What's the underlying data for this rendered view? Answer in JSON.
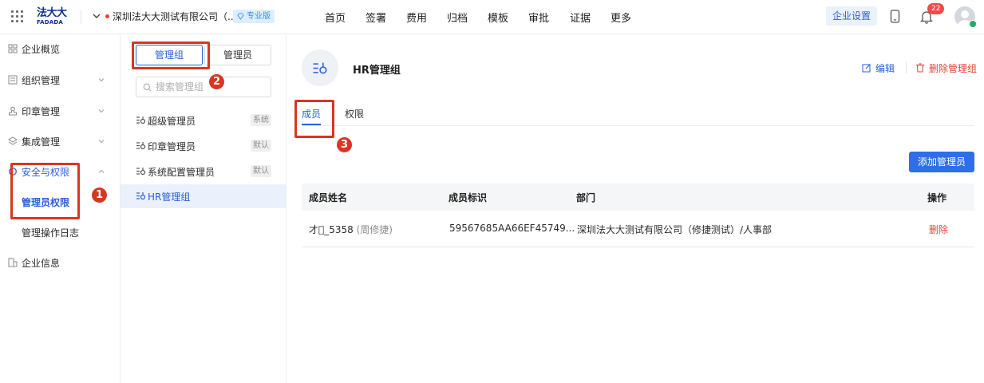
{
  "header": {
    "logo_line1": "法大大",
    "logo_line2": "FADADA",
    "org_name": "深圳法大大测试有限公司（...",
    "pro_badge": "专业版",
    "nav": [
      "首页",
      "签署",
      "费用",
      "归档",
      "模板",
      "审批",
      "证据",
      "更多"
    ],
    "settings_button": "企业设置",
    "notification_count": "22"
  },
  "sidebar": {
    "items": [
      {
        "label": "企业概览"
      },
      {
        "label": "组织管理"
      },
      {
        "label": "印章管理"
      },
      {
        "label": "集成管理"
      },
      {
        "label": "安全与权限"
      },
      {
        "label": "企业信息"
      }
    ],
    "sub_items": [
      {
        "label": "管理员权限"
      },
      {
        "label": "管理操作日志"
      }
    ]
  },
  "groups_panel": {
    "tab_groups": "管理组",
    "tab_admins": "管理员",
    "search_placeholder": "搜索管理组",
    "groups": [
      {
        "name": "超级管理员",
        "tag": "系统"
      },
      {
        "name": "印章管理员",
        "tag": "默认"
      },
      {
        "name": "系统配置管理员",
        "tag": "默认"
      },
      {
        "name": "HR管理组",
        "tag": ""
      }
    ]
  },
  "detail": {
    "title": "HR管理组",
    "edit_label": "编辑",
    "delete_label": "删除管理组",
    "tabs": [
      "成员",
      "权限"
    ],
    "add_button": "添加管理员",
    "columns": [
      "成员姓名",
      "成员标识",
      "部门",
      "操作"
    ],
    "rows": [
      {
        "name": "才\u0000_5358",
        "alias": "(周修捷)",
        "id": "59567685AA66EF45749...",
        "dept": "深圳法大大测试有限公司（修捷测试）/人事部",
        "action": "删除"
      }
    ]
  },
  "annotations": [
    "1",
    "2",
    "3"
  ],
  "colors": {
    "accent": "#2b5fd9",
    "danger": "#e0473a",
    "annotation": "#d93622"
  }
}
